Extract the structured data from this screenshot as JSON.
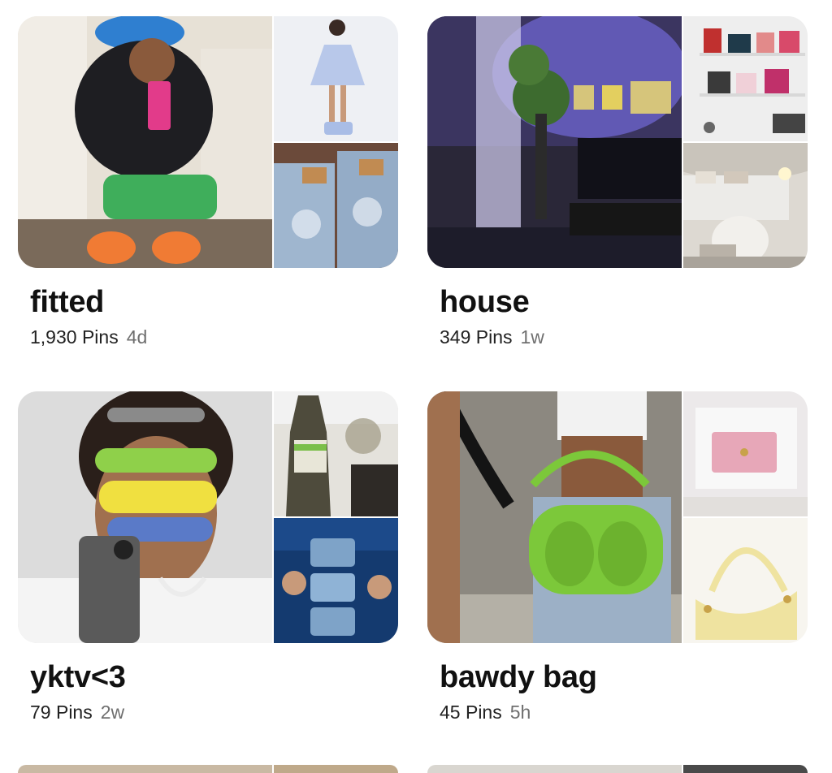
{
  "boards": [
    {
      "title": "fitted",
      "pins": "1,930 Pins",
      "age": "4d",
      "images": [
        {
          "icon": "outfit-photo",
          "colors": [
            "#e7e1d6",
            "#1e1e22",
            "#3fae5b",
            "#f07b34"
          ]
        },
        {
          "icon": "dress-photo",
          "colors": [
            "#eef0f4",
            "#b8c8ea"
          ]
        },
        {
          "icon": "jeans-photo",
          "colors": [
            "#6b4a3a",
            "#9fb6cf"
          ]
        }
      ]
    },
    {
      "title": "house",
      "pins": "349 Pins",
      "age": "1w",
      "images": [
        {
          "icon": "room-photo",
          "colors": [
            "#1d1c2a",
            "#6b63c9",
            "#d6c57b",
            "#3d6b2f"
          ]
        },
        {
          "icon": "bookshelf-photo",
          "colors": [
            "#eeeeee",
            "#c0302f"
          ]
        },
        {
          "icon": "bedroom-photo",
          "colors": [
            "#ddd9d2",
            "#b9b2a8"
          ]
        }
      ]
    },
    {
      "title": "yktv<3",
      "pins": "79 Pins",
      "age": "2w",
      "images": [
        {
          "icon": "sunglasses-portrait-photo",
          "colors": [
            "#dcdcdc",
            "#2a1f1a",
            "#8fd04a",
            "#f0e040"
          ]
        },
        {
          "icon": "bottle-photo",
          "colors": [
            "#4e4b3c",
            "#a7a38f"
          ]
        },
        {
          "icon": "phone-crowd-photo",
          "colors": [
            "#143a6f",
            "#7ea3c8"
          ]
        }
      ]
    },
    {
      "title": "bawdy bag",
      "pins": "45 Pins",
      "age": "5h",
      "images": [
        {
          "icon": "green-bag-photo",
          "colors": [
            "#8c8880",
            "#7cc83a",
            "#9cb0c6",
            "#f2f2f2"
          ]
        },
        {
          "icon": "pink-wallet-photo",
          "colors": [
            "#ece9ea",
            "#e7a7b8"
          ]
        },
        {
          "icon": "yellow-bag-photo",
          "colors": [
            "#f7f5ef",
            "#efe3a0"
          ]
        }
      ]
    }
  ]
}
